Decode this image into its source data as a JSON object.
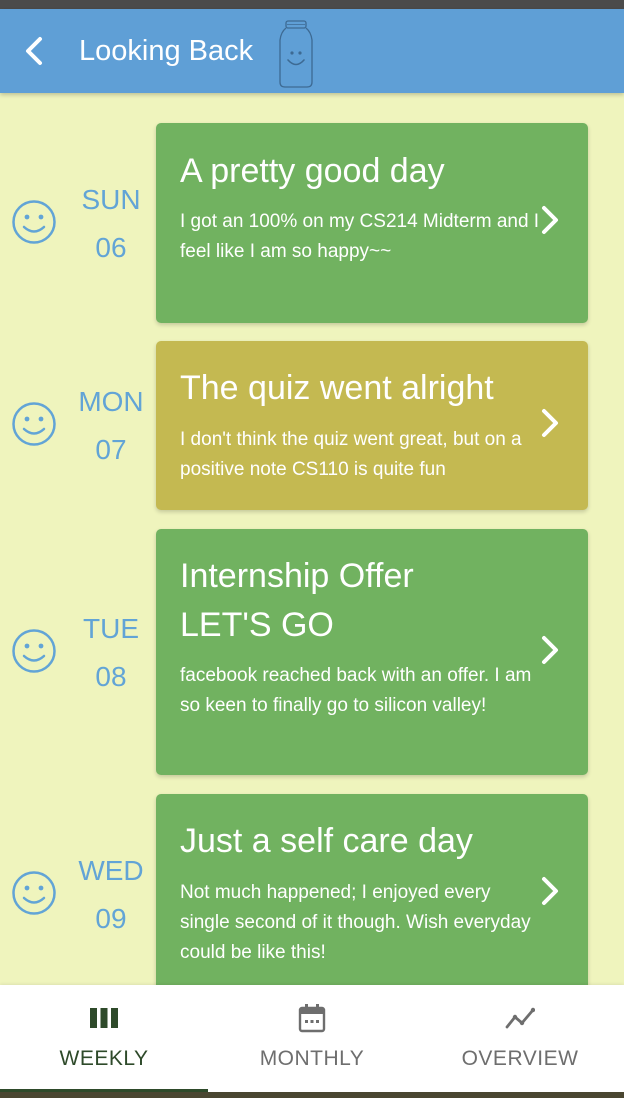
{
  "header": {
    "title": "Looking Back"
  },
  "entries": [
    {
      "day": "SUN",
      "date": "06",
      "title": "A pretty good day",
      "body": "I got an 100% on my CS214 Midterm and I feel like I am so happy~~",
      "color": "#71b260"
    },
    {
      "day": "MON",
      "date": "07",
      "title": "The quiz went alright",
      "body": "I don't think the quiz went great, but on a positive note CS110 is quite fun",
      "color": "#c4b951"
    },
    {
      "day": "TUE",
      "date": "08",
      "title": "Internship Offer\nLET'S GO",
      "body": "facebook reached back with an offer. I am so keen to finally go to silicon valley!",
      "color": "#71b260"
    },
    {
      "day": "WED",
      "date": "09",
      "title": "Just a self care day",
      "body": "Not much happened; I enjoyed every single second of it though. Wish everyday could be like this!",
      "color": "#71b260"
    }
  ],
  "tabs": [
    {
      "label": "WEEKLY",
      "icon": "bar-chart-icon",
      "active": true,
      "color": "#2e4a2a"
    },
    {
      "label": "MONTHLY",
      "icon": "calendar-icon",
      "active": false,
      "color": "#6e6e6e"
    },
    {
      "label": "OVERVIEW",
      "icon": "trend-line-icon",
      "active": false,
      "color": "#6e6e6e"
    }
  ],
  "colors": {
    "header": "#5f9fd6",
    "background": "#eff4bd",
    "day_text": "#62a4d6",
    "mood_icon": "#62a4d6"
  }
}
